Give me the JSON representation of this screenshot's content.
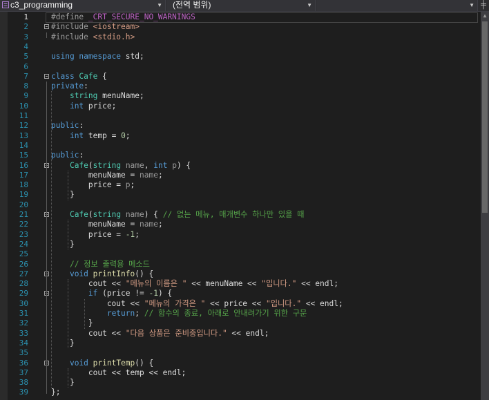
{
  "nav": {
    "project": "c3_programming",
    "scope": "(전역 범위)",
    "member": "",
    "split_icon": "split-pane-icon",
    "dropdown_icon": "chevron-down-icon"
  },
  "editor": {
    "current_line": 1,
    "lines": [
      {
        "n": "1",
        "segs": [
          {
            "t": "#define ",
            "c": "pp"
          },
          {
            "t": "_CRT_SECURE_NO_WARNINGS",
            "c": "mac"
          }
        ]
      },
      {
        "n": "2",
        "segs": [
          {
            "t": "#include ",
            "c": "pp"
          },
          {
            "t": "<iostream>",
            "c": "str"
          }
        ]
      },
      {
        "n": "3",
        "segs": [
          {
            "t": "#include ",
            "c": "pp"
          },
          {
            "t": "<stdio.h>",
            "c": "str"
          }
        ]
      },
      {
        "n": "4",
        "segs": []
      },
      {
        "n": "5",
        "segs": [
          {
            "t": "using ",
            "c": "kw"
          },
          {
            "t": "namespace ",
            "c": "kw"
          },
          {
            "t": "std;",
            "c": ""
          }
        ]
      },
      {
        "n": "6",
        "segs": []
      },
      {
        "n": "7",
        "segs": [
          {
            "t": "class ",
            "c": "kw"
          },
          {
            "t": "Cafe",
            "c": "ty"
          },
          {
            "t": " {",
            "c": ""
          }
        ]
      },
      {
        "n": "8",
        "segs": [
          {
            "t": "private",
            "c": "kw"
          },
          {
            "t": ":",
            "c": ""
          }
        ]
      },
      {
        "n": "9",
        "segs": [
          {
            "t": "    "
          },
          {
            "t": "string ",
            "c": "ty"
          },
          {
            "t": "menuName;",
            "c": ""
          }
        ]
      },
      {
        "n": "10",
        "segs": [
          {
            "t": "    "
          },
          {
            "t": "int ",
            "c": "kw"
          },
          {
            "t": "price;",
            "c": ""
          }
        ]
      },
      {
        "n": "11",
        "segs": []
      },
      {
        "n": "12",
        "segs": [
          {
            "t": "public",
            "c": "kw"
          },
          {
            "t": ":",
            "c": ""
          }
        ]
      },
      {
        "n": "13",
        "segs": [
          {
            "t": "    "
          },
          {
            "t": "int ",
            "c": "kw"
          },
          {
            "t": "temp = ",
            "c": ""
          },
          {
            "t": "0",
            "c": "num"
          },
          {
            "t": ";",
            "c": ""
          }
        ]
      },
      {
        "n": "14",
        "segs": []
      },
      {
        "n": "15",
        "segs": [
          {
            "t": "public",
            "c": "kw"
          },
          {
            "t": ":",
            "c": ""
          }
        ]
      },
      {
        "n": "16",
        "segs": [
          {
            "t": "    "
          },
          {
            "t": "Cafe",
            "c": "ty"
          },
          {
            "t": "(",
            "c": ""
          },
          {
            "t": "string ",
            "c": "ty"
          },
          {
            "t": "name",
            "c": "par"
          },
          {
            "t": ", ",
            "c": ""
          },
          {
            "t": "int ",
            "c": "kw"
          },
          {
            "t": "p",
            "c": "par"
          },
          {
            "t": ") {",
            "c": ""
          }
        ]
      },
      {
        "n": "17",
        "segs": [
          {
            "t": "        menuName = "
          },
          {
            "t": "name",
            "c": "par"
          },
          {
            "t": ";",
            "c": ""
          }
        ]
      },
      {
        "n": "18",
        "segs": [
          {
            "t": "        price = "
          },
          {
            "t": "p",
            "c": "par"
          },
          {
            "t": ";",
            "c": ""
          }
        ]
      },
      {
        "n": "19",
        "segs": [
          {
            "t": "    }"
          }
        ]
      },
      {
        "n": "20",
        "segs": []
      },
      {
        "n": "21",
        "segs": [
          {
            "t": "    "
          },
          {
            "t": "Cafe",
            "c": "ty"
          },
          {
            "t": "(",
            "c": ""
          },
          {
            "t": "string ",
            "c": "ty"
          },
          {
            "t": "name",
            "c": "par"
          },
          {
            "t": ") { ",
            "c": ""
          },
          {
            "t": "// 없는 메뉴, 매개변수 하나만 있을 때",
            "c": "cmt"
          }
        ]
      },
      {
        "n": "22",
        "segs": [
          {
            "t": "        menuName = "
          },
          {
            "t": "name",
            "c": "par"
          },
          {
            "t": ";",
            "c": ""
          }
        ]
      },
      {
        "n": "23",
        "segs": [
          {
            "t": "        price = "
          },
          {
            "t": "-1",
            "c": "num"
          },
          {
            "t": ";",
            "c": ""
          }
        ]
      },
      {
        "n": "24",
        "segs": [
          {
            "t": "    }"
          }
        ]
      },
      {
        "n": "25",
        "segs": []
      },
      {
        "n": "26",
        "segs": [
          {
            "t": "    "
          },
          {
            "t": "// 정보 출력용 메소드",
            "c": "cmt"
          }
        ]
      },
      {
        "n": "27",
        "segs": [
          {
            "t": "    "
          },
          {
            "t": "void ",
            "c": "kw"
          },
          {
            "t": "printInfo",
            "c": "fn"
          },
          {
            "t": "() {",
            "c": ""
          }
        ]
      },
      {
        "n": "28",
        "segs": [
          {
            "t": "        cout << "
          },
          {
            "t": "\"메뉴의 이름은 \"",
            "c": "str"
          },
          {
            "t": " << menuName << ",
            "c": ""
          },
          {
            "t": "\"입니다.\"",
            "c": "str"
          },
          {
            "t": " << endl;",
            "c": ""
          }
        ]
      },
      {
        "n": "29",
        "segs": [
          {
            "t": "        "
          },
          {
            "t": "if ",
            "c": "kw"
          },
          {
            "t": "(price != ",
            "c": ""
          },
          {
            "t": "-1",
            "c": "num"
          },
          {
            "t": ") {",
            "c": ""
          }
        ]
      },
      {
        "n": "30",
        "segs": [
          {
            "t": "            cout << "
          },
          {
            "t": "\"메뉴의 가격은 \"",
            "c": "str"
          },
          {
            "t": " << price << ",
            "c": ""
          },
          {
            "t": "\"입니다.\"",
            "c": "str"
          },
          {
            "t": " << endl;",
            "c": ""
          }
        ]
      },
      {
        "n": "31",
        "segs": [
          {
            "t": "            "
          },
          {
            "t": "return",
            "c": "kw"
          },
          {
            "t": "; ",
            "c": ""
          },
          {
            "t": "// 함수의 종료, 아래로 안내려가기 위한 구문",
            "c": "cmt"
          }
        ]
      },
      {
        "n": "32",
        "segs": [
          {
            "t": "        }"
          }
        ]
      },
      {
        "n": "33",
        "segs": [
          {
            "t": "        cout << "
          },
          {
            "t": "\"다음 상품은 준비중입니다.\"",
            "c": "str"
          },
          {
            "t": " << endl;",
            "c": ""
          }
        ]
      },
      {
        "n": "34",
        "segs": [
          {
            "t": "    }"
          }
        ]
      },
      {
        "n": "35",
        "segs": []
      },
      {
        "n": "36",
        "segs": [
          {
            "t": "    "
          },
          {
            "t": "void ",
            "c": "kw"
          },
          {
            "t": "printTemp",
            "c": "fn"
          },
          {
            "t": "() {",
            "c": ""
          }
        ]
      },
      {
        "n": "37",
        "segs": [
          {
            "t": "        cout << temp << endl;"
          }
        ]
      },
      {
        "n": "38",
        "segs": [
          {
            "t": "    }"
          }
        ]
      },
      {
        "n": "39",
        "segs": [
          {
            "t": "};"
          }
        ]
      }
    ]
  }
}
